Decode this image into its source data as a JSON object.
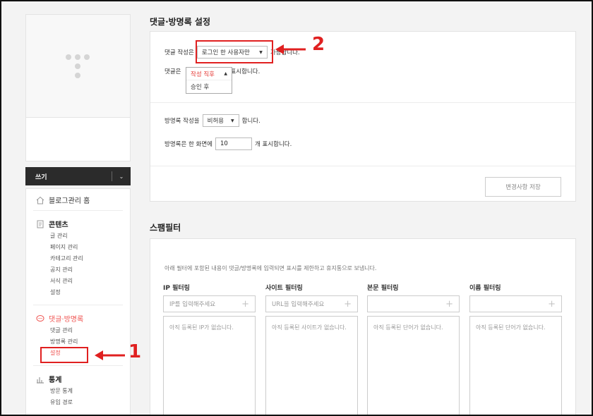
{
  "sidebar": {
    "write_label": "쓰기",
    "home_label": "블로그관리 홈",
    "content_group": {
      "title": "콘텐츠",
      "items": [
        "글 관리",
        "페이지 관리",
        "카테고리 관리",
        "공지 관리",
        "서식 관리",
        "설정"
      ]
    },
    "comment_group": {
      "title": "댓글·방명록",
      "items": [
        "댓글 관리",
        "방명록 관리",
        "설정"
      ]
    },
    "stats_group": {
      "title": "통계",
      "items": [
        "방문 통계",
        "유입 경로"
      ]
    }
  },
  "settings": {
    "title": "댓글·방명록 설정",
    "comment_write": {
      "prefix": "댓글 작성은",
      "select_value": "로그인 한 사용자만",
      "suffix": "가능합니다."
    },
    "comment_display": {
      "prefix": "댓글은",
      "suffix": "표시합니다.",
      "selected": "작성 직후",
      "options": [
        "작성 직후",
        "승인 후"
      ]
    },
    "guestbook_write": {
      "prefix": "방명록 작성을",
      "select_value": "비허용",
      "suffix": "합니다."
    },
    "guestbook_count": {
      "prefix": "방명록은 한 화면에",
      "value": "10",
      "suffix": "개 표시합니다."
    },
    "save_label": "변경사항 저장"
  },
  "spam": {
    "title": "스팸필터",
    "description": "아래 필터에 포함된 내용이 댓글/방명록에 입력되면 표시를 제한하고 휴지통으로 보냅니다.",
    "filters": [
      {
        "label": "IP 필터링",
        "placeholder": "IP를 입력해주세요",
        "empty": "아직 등록된 IP가 없습니다."
      },
      {
        "label": "사이트 필터링",
        "placeholder": "URL을 입력해주세요",
        "empty": "아직 등록된 사이트가 없습니다."
      },
      {
        "label": "본문 필터링",
        "placeholder": "",
        "empty": "아직 등록된 단어가 없습니다."
      },
      {
        "label": "이름 필터링",
        "placeholder": "",
        "empty": "아직 등록된 단어가 없습니다."
      }
    ]
  },
  "annotations": {
    "num1": "1",
    "num2": "2",
    "color": "#e02020"
  },
  "colors": {
    "accent": "#ef5350",
    "selected_option": "#e53935",
    "write_bar": "#2b2b2b"
  }
}
